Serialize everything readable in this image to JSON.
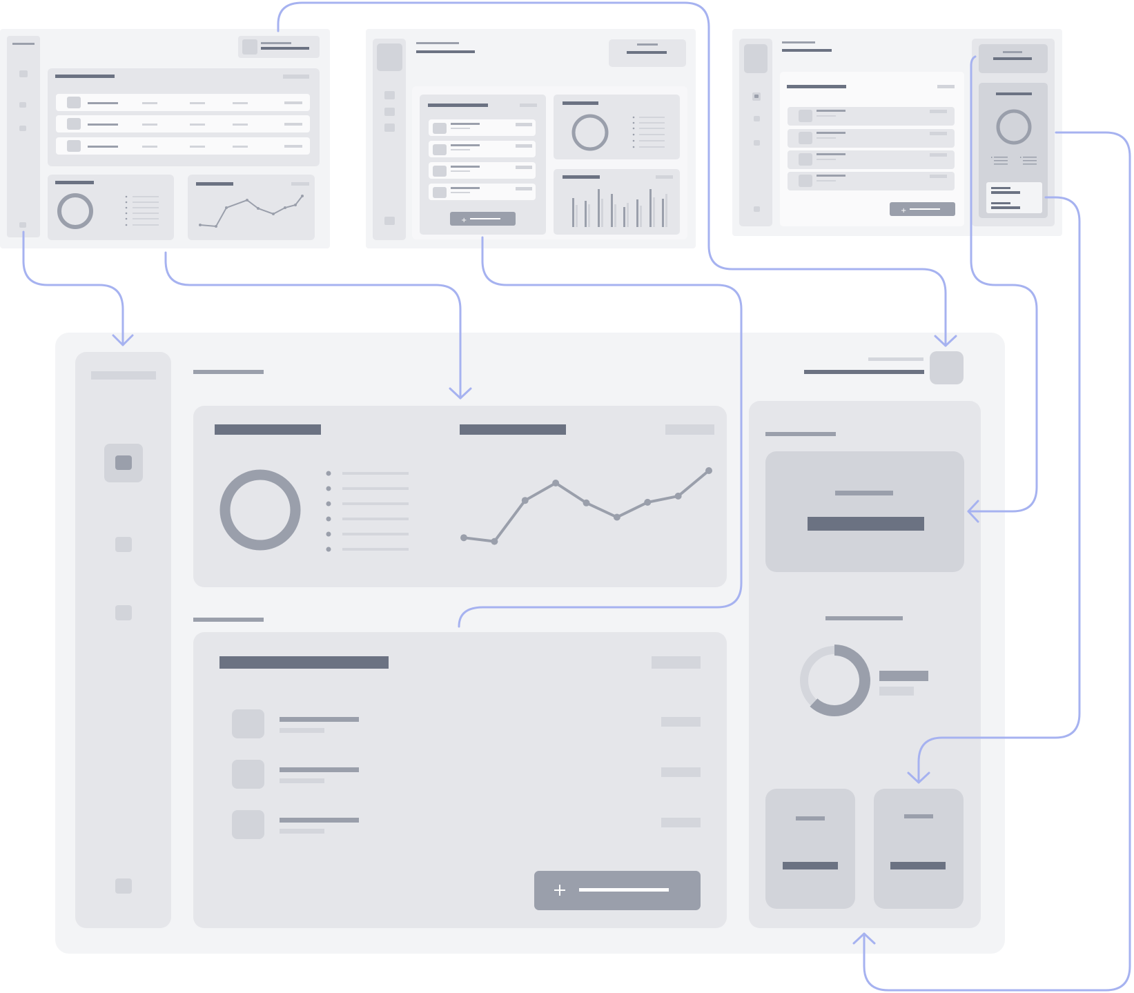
{
  "colors": {
    "background": "#ffffff",
    "panel": "#f3f4f6",
    "card": "#e5e6ea",
    "block": "#d2d4da",
    "bar_light": "#d4d6dc",
    "bar_mid": "#9a9fab",
    "bar_dark": "#6b7282",
    "white_card": "#fafafb",
    "connector": "#a6b2f0"
  },
  "icons": {
    "add_button": "plus-icon",
    "connector_arrow": "arrow-head-icon"
  },
  "thumbnails": [
    {
      "name": "wireframe-thumbnail-table-layout",
      "widgets": [
        "data-table",
        "donut-chart",
        "line-chart"
      ]
    },
    {
      "name": "wireframe-thumbnail-list-layout",
      "widgets": [
        "list",
        "add-button",
        "donut-chart",
        "bar-chart"
      ]
    },
    {
      "name": "wireframe-thumbnail-sidebar-layout",
      "widgets": [
        "list",
        "add-button",
        "side-panel"
      ]
    }
  ],
  "main_wireframe": {
    "widgets": [
      "sidebar",
      "donut-chart",
      "line-chart",
      "list",
      "add-button",
      "stat-card",
      "pie-chart",
      "mini-stat-cards"
    ],
    "line_trend": [
      0.12,
      0.06,
      0.72,
      1.0,
      0.68,
      0.45,
      0.69,
      0.79,
      1.2
    ],
    "list_rows": 3,
    "legend_items": 6,
    "pie_fraction": 0.62
  }
}
